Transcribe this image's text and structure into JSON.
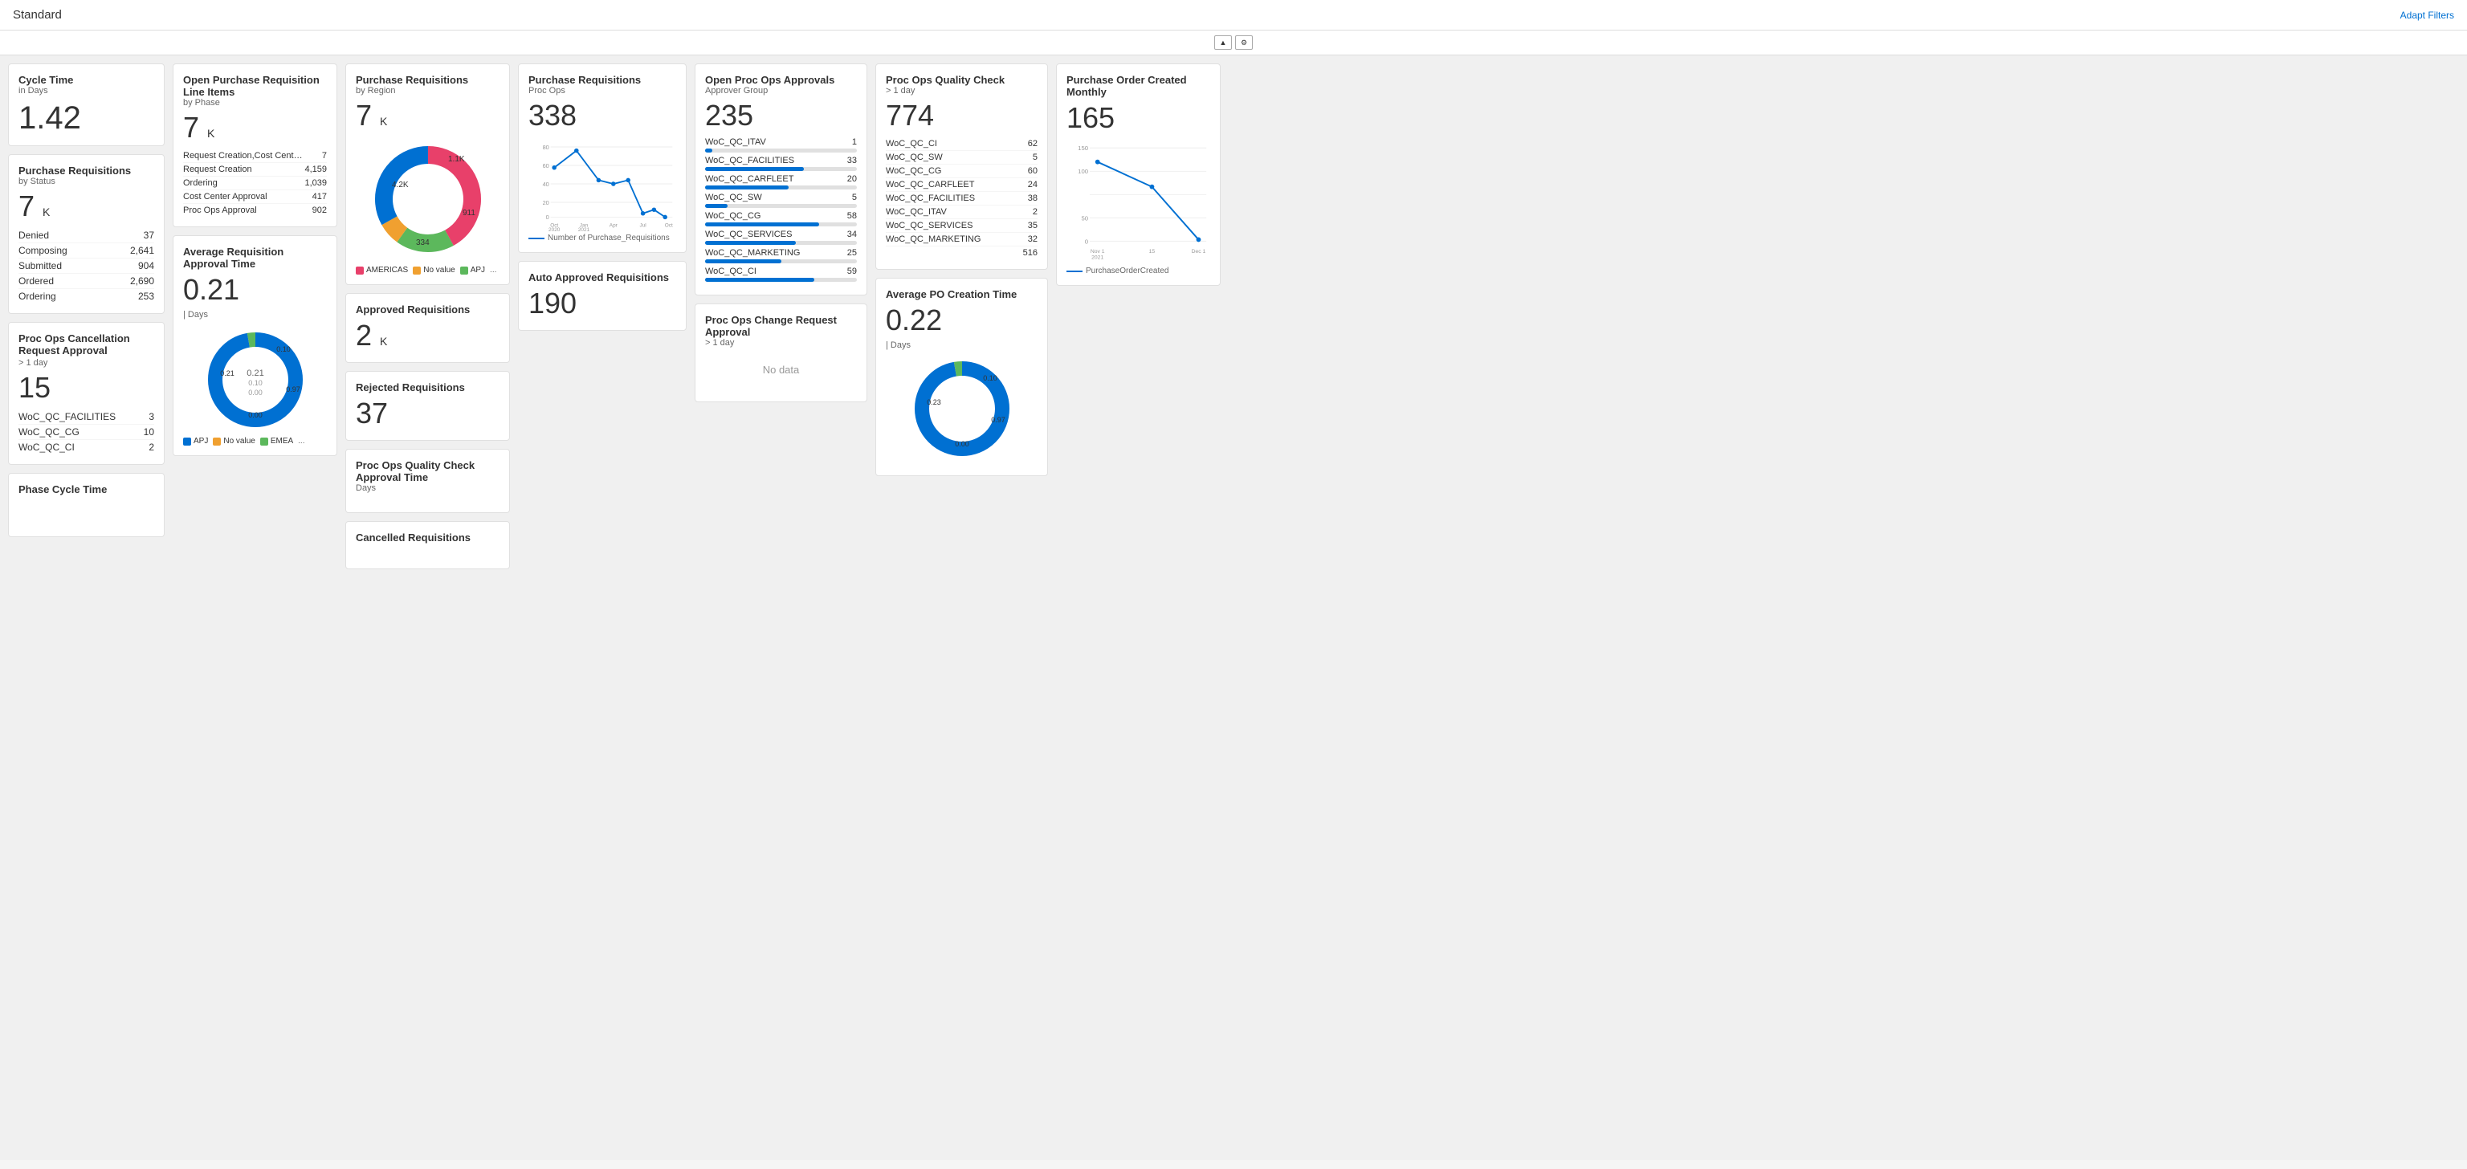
{
  "header": {
    "title": "Standard",
    "adapt_filters": "Adapt Filters"
  },
  "kpis": {
    "cycle_time": {
      "title": "Cycle Time",
      "subtitle": "in Days",
      "value": "1.42"
    },
    "purchase_req_status": {
      "title": "Purchase Requisitions",
      "subtitle": "by Status",
      "value": "7",
      "unit": "K",
      "rows": [
        {
          "label": "Denied",
          "value": "37"
        },
        {
          "label": "Composing",
          "value": "2,641"
        },
        {
          "label": "Submitted",
          "value": "904"
        },
        {
          "label": "Ordered",
          "value": "2,690"
        },
        {
          "label": "Ordering",
          "value": "253"
        }
      ]
    },
    "proc_ops_cancel": {
      "title": "Proc Ops Cancellation Request Approval",
      "subtitle": "> 1 day",
      "value": "15",
      "rows": [
        {
          "label": "WoC_QC_FACILITIES",
          "value": "3"
        },
        {
          "label": "WoC_QC_CG",
          "value": "10"
        },
        {
          "label": "WoC_QC_CI",
          "value": "2"
        }
      ]
    },
    "open_pr_line": {
      "title": "Open Purchase Requisition Line Items",
      "subtitle": "by Phase",
      "value": "7",
      "unit": "K",
      "rows": [
        {
          "label": "Request Creation,Cost Center Ap...",
          "value": "7"
        },
        {
          "label": "Request Creation",
          "value": "4,159"
        },
        {
          "label": "Ordering",
          "value": "1,039"
        },
        {
          "label": "Cost Center Approval",
          "value": "417"
        },
        {
          "label": "Proc Ops Approval",
          "value": "902"
        }
      ]
    },
    "avg_req_approval": {
      "title": "Average Requisition Approval Time",
      "value": "0.21",
      "unit_label": "| Days"
    },
    "purchase_req_region": {
      "title": "Purchase Requisitions",
      "subtitle": "by Region",
      "value": "7",
      "unit": "K",
      "donut": {
        "segments": [
          {
            "label": "AMERICAS",
            "color": "#e8406a",
            "value": 4200,
            "pct": 0.42
          },
          {
            "label": "No value",
            "color": "#f0a030",
            "value": 334,
            "pct": 0.07
          },
          {
            "label": "APJ",
            "color": "#5cb85c",
            "value": 911,
            "pct": 0.18
          },
          {
            "label": "...",
            "color": "#0070d2",
            "value": 1100,
            "pct": 0.33
          }
        ],
        "labels": [
          "4.2K",
          "1.1K",
          "911",
          "334"
        ]
      }
    },
    "approved_req": {
      "title": "Approved Requisitions",
      "value": "2",
      "unit": "K"
    },
    "rejected_req": {
      "title": "Rejected Requisitions",
      "value": "37"
    },
    "purchase_req_proc_ops": {
      "title": "Purchase Requisitions",
      "subtitle": "Proc Ops",
      "value": "338",
      "chart_label": "Number of Purchase_Requisitions",
      "x_labels": [
        "Oct 2020",
        "Jan 2021",
        "Apr",
        "Jul",
        "Oct"
      ],
      "y_labels": [
        "0",
        "20",
        "40",
        "60",
        "80"
      ]
    },
    "auto_approved": {
      "title": "Auto Approved Requisitions",
      "value": "190"
    },
    "proc_ops_quality_check_time": {
      "title": "Proc Ops Quality Check Approval Time",
      "subtitle": "Days"
    },
    "cancelled_req": {
      "title": "Cancelled Requisitions"
    },
    "open_proc_ops_approvals": {
      "title": "Open Proc Ops Approvals",
      "subtitle": "Approver Group",
      "value": "235",
      "rows": [
        {
          "label": "WoC_QC_ITAV",
          "value": "1",
          "pct": 5
        },
        {
          "label": "WoC_QC_FACILITIES",
          "value": "33",
          "pct": 65
        },
        {
          "label": "WoC_QC_CARFLEET",
          "value": "20",
          "pct": 55
        },
        {
          "label": "WoC_QC_SW",
          "value": "5",
          "pct": 15
        },
        {
          "label": "WoC_QC_CG",
          "value": "58",
          "pct": 75
        },
        {
          "label": "WoC_QC_SERVICES",
          "value": "34",
          "pct": 60
        },
        {
          "label": "WoC_QC_MARKETING",
          "value": "25",
          "pct": 50
        },
        {
          "label": "WoC_QC_CI",
          "value": "59",
          "pct": 72
        }
      ]
    },
    "proc_ops_change": {
      "title": "Proc Ops Change Request Approval",
      "subtitle": "> 1 day",
      "no_data": "No data"
    },
    "proc_ops_quality_check": {
      "title": "Proc Ops Quality Check",
      "subtitle": "> 1 day",
      "value": "774",
      "rows": [
        {
          "label": "WoC_QC_CI",
          "value": "62"
        },
        {
          "label": "WoC_QC_SW",
          "value": "5"
        },
        {
          "label": "WoC_QC_CG",
          "value": "60"
        },
        {
          "label": "WoC_QC_CARFLEET",
          "value": "24"
        },
        {
          "label": "WoC_QC_FACILITIES",
          "value": "38"
        },
        {
          "label": "WoC_QC_ITAV",
          "value": "2"
        },
        {
          "label": "WoC_QC_SERVICES",
          "value": "35"
        },
        {
          "label": "WoC_QC_MARKETING",
          "value": "32"
        },
        {
          "label": "",
          "value": "516"
        }
      ]
    },
    "avg_po_creation": {
      "title": "Average PO Creation Time",
      "value": "0.22",
      "unit_label": "| Days"
    },
    "po_created_monthly": {
      "title": "Purchase Order Created Monthly",
      "value": "165",
      "x_labels": [
        "Nov 1 2021",
        "15",
        "Dec 1"
      ],
      "chart_label": "PurchaseOrderCreated"
    }
  }
}
